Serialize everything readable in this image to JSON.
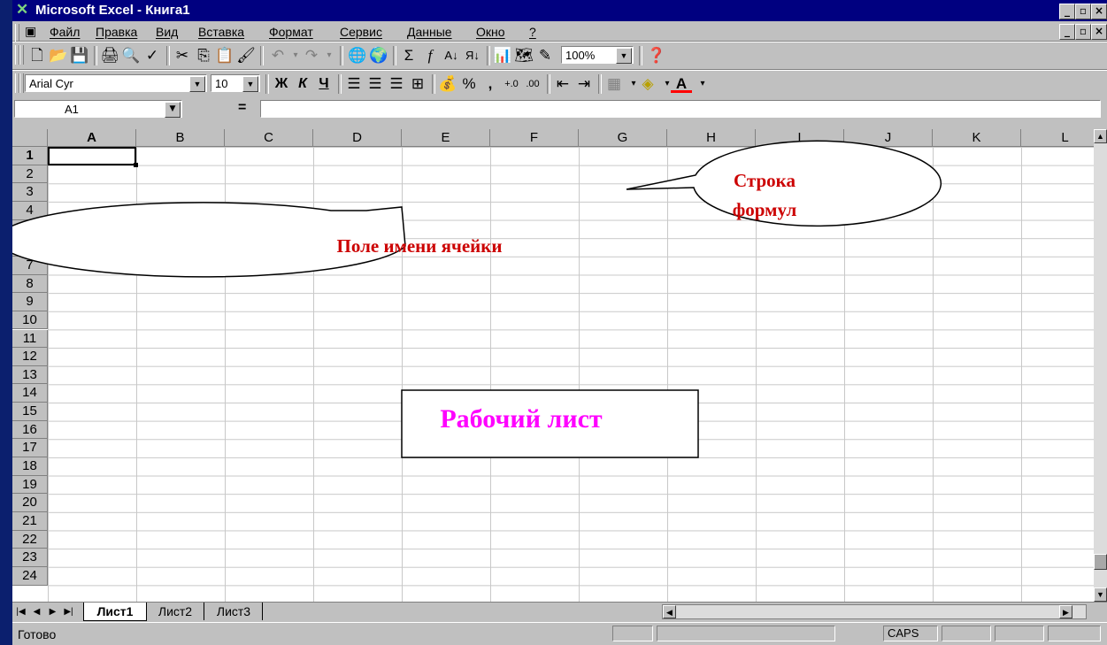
{
  "window": {
    "title": "Microsoft Excel - Книга1",
    "min": "_",
    "max": "▫",
    "close": "×"
  },
  "menu": [
    "Файл",
    "Правка",
    "Вид",
    "Вставка",
    "Формат",
    "Сервис",
    "Данные",
    "Окно",
    "?"
  ],
  "toolbar": {
    "zoom": "100%"
  },
  "format_toolbar": {
    "font_name": "Arial Cyr",
    "font_size": "10",
    "bold": "Ж",
    "italic": "К",
    "underline": "Ч"
  },
  "formula_bar": {
    "name_box": "A1",
    "equals": "="
  },
  "columns": [
    "A",
    "B",
    "C",
    "D",
    "E",
    "F",
    "G",
    "H",
    "I",
    "J",
    "K",
    "L"
  ],
  "rows": [
    "1",
    "2",
    "3",
    "4",
    "5",
    "6",
    "7",
    "8",
    "9",
    "10",
    "11",
    "12",
    "13",
    "14",
    "15",
    "16",
    "17",
    "18",
    "19",
    "20",
    "21",
    "22",
    "23",
    "24"
  ],
  "sheets": [
    "Лист1",
    "Лист2",
    "Лист3"
  ],
  "status": {
    "ready": "Готово",
    "caps": "CAPS"
  },
  "callouts": {
    "formula_bar": "Строка формул",
    "name_box": "Поле имени ячейки",
    "worksheet": "Рабочий лист"
  },
  "colors": {
    "callout_text": "#cc0000",
    "worksheet_text": "#ff00ff",
    "title_bar": "#000080"
  }
}
